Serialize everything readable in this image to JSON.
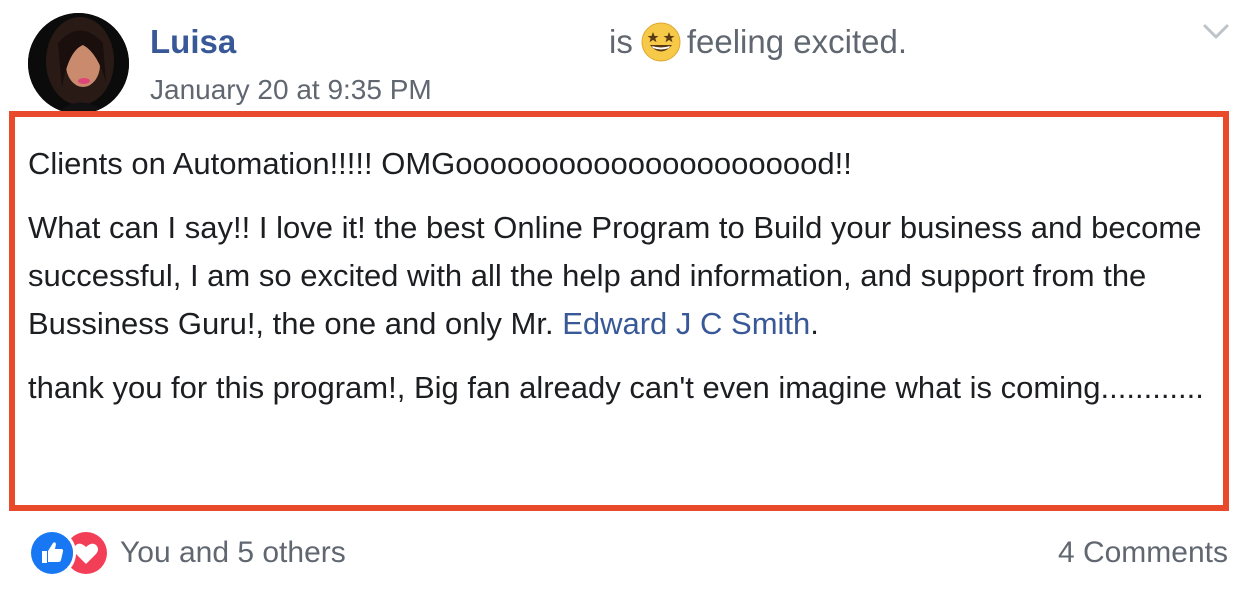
{
  "header": {
    "author_name": "Luisa",
    "feeling_prefix": "is",
    "feeling_text": "feeling excited.",
    "feeling_icon": "star-struck-emoji-icon",
    "timestamp": "January 20 at 9:35 PM"
  },
  "post": {
    "line1": "Clients on Automation!!!!! OMGoooooooooooooooooooood!!",
    "para2_text": "What can I say!! I love it! the best Online Program to Build your business and become successful, I am so excited with all the help and information, and support from the Bussiness Guru!, the one and only Mr.",
    "mention": "Edward J C Smith",
    "para2_end": ".",
    "para3": "thank you for this program!, Big fan already can't even imagine what is coming............"
  },
  "footer": {
    "reactions_text": "You and 5 others",
    "comments_text": "4 Comments"
  },
  "colors": {
    "link": "#385898",
    "highlight_border": "#ea4a2c",
    "secondary_text": "#616770",
    "like_blue": "#1877f2",
    "love_red": "#f33e58"
  }
}
